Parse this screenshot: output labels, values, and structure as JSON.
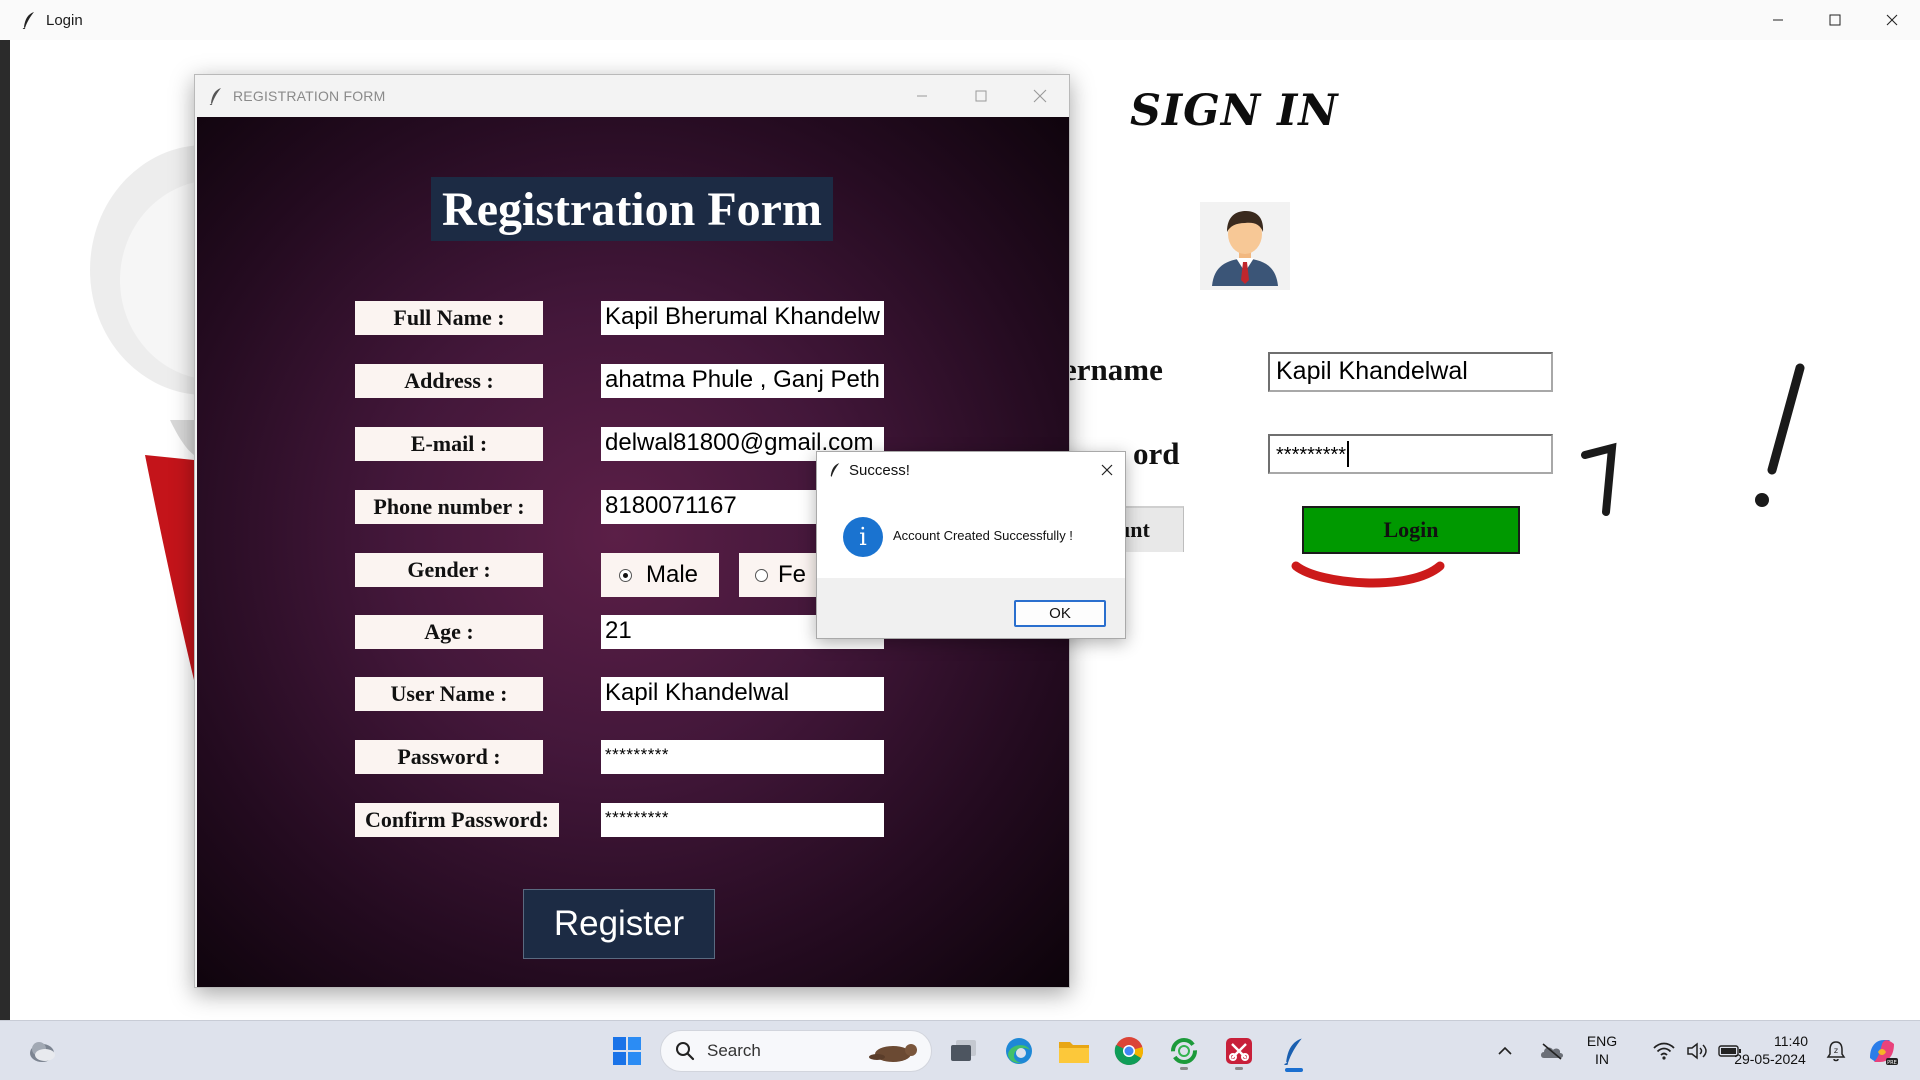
{
  "login_window": {
    "title": "Login",
    "heading": "SIGN IN",
    "username_label": "ername",
    "password_label": "ord",
    "username_value": "Kapil Khandelwal",
    "password_value": "*********",
    "create_account_label": "unt",
    "login_button": "Login"
  },
  "registration_window": {
    "title": "REGISTRATION FORM",
    "heading": "Registration Form",
    "fields": [
      {
        "label": "Full Name :",
        "value": "Kapil Bherumal  Khandelw"
      },
      {
        "label": "Address :",
        "value": "ahatma Phule , Ganj Peth"
      },
      {
        "label": "E-mail :",
        "value": "delwal81800@gmail.com"
      },
      {
        "label": "Phone number :",
        "value": "8180071167"
      },
      {
        "label": "Gender :",
        "value": ""
      },
      {
        "label": "Age :",
        "value": "21"
      },
      {
        "label": "User Name :",
        "value": "Kapil Khandelwal"
      },
      {
        "label": "Password :",
        "value": "*********"
      },
      {
        "label": "Confirm Password:",
        "value": "*********"
      }
    ],
    "gender_options": [
      "Male",
      "Fe"
    ],
    "gender_selected": "Male",
    "register_button": "Register"
  },
  "dialog": {
    "title": "Success!",
    "message": "Account Created Successfully !",
    "ok_button": "OK"
  },
  "taskbar": {
    "search_placeholder": "Search",
    "language_line1": "ENG",
    "language_line2": "IN",
    "time": "11:40",
    "date": "29-05-2024"
  },
  "colors": {
    "login_button_bg": "#009900",
    "form_heading_bg": "#1c2b44",
    "form_bg": "#43173a",
    "info_icon": "#1a73d0"
  }
}
